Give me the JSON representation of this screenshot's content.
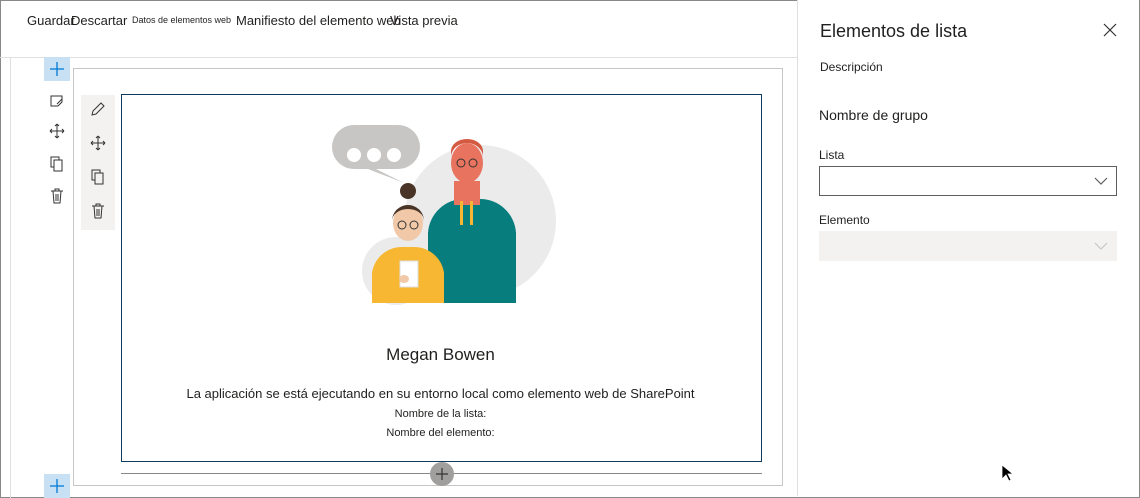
{
  "toolbar": {
    "save": "Guardar",
    "discard": "Descartar",
    "web_part_data": "Datos de elementos web",
    "manifest": "Manifiesto del elemento web",
    "preview": "Vista previa"
  },
  "webpart": {
    "user_name": "Megan Bowen",
    "description": "La aplicación se está ejecutando en su entorno local como elemento web de SharePoint",
    "list_name_label": "Nombre de la lista:",
    "item_name_label": "Nombre del elemento:"
  },
  "panel": {
    "title": "Elementos de lista",
    "description_label": "Descripción",
    "group_name": "Nombre de grupo",
    "list_label": "Lista",
    "list_value": "",
    "item_label": "Elemento",
    "item_value": ""
  },
  "colors": {
    "accent": "#0078d4",
    "add_button_bg": "#c7e0f4",
    "webpart_border": "#0f3b5f",
    "teal_jacket": "#077d7d",
    "yellow_jacket": "#f7b733"
  },
  "icons": [
    "add-icon",
    "edit-section-icon",
    "move-icon",
    "duplicate-icon",
    "delete-icon",
    "pencil-icon",
    "close-icon",
    "chevron-down-icon",
    "cursor-icon"
  ]
}
